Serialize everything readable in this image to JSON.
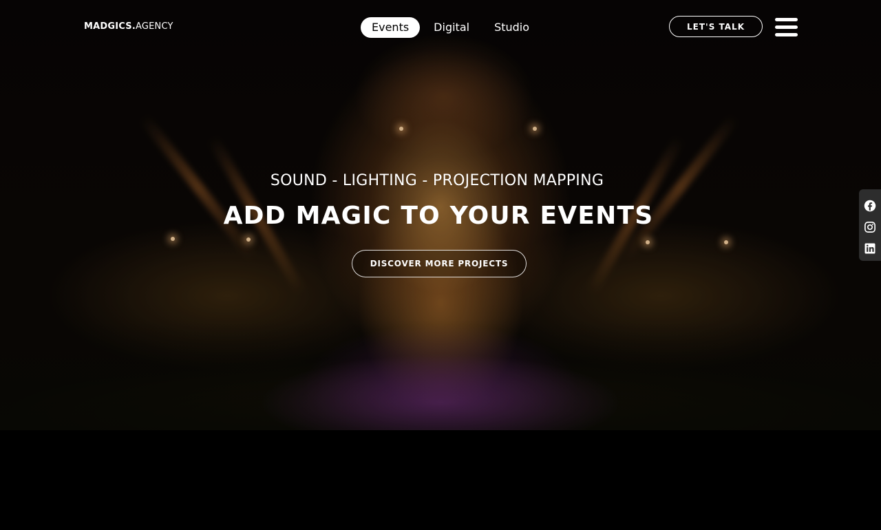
{
  "header": {
    "logo_main": "MADGICS.",
    "logo_suffix": "AGENCY",
    "nav": [
      {
        "label": "Events",
        "active": true
      },
      {
        "label": "Digital",
        "active": false
      },
      {
        "label": "Studio",
        "active": false
      }
    ],
    "cta_label": "LET'S TALK",
    "menu_icon": "hamburger-menu-icon"
  },
  "hero": {
    "kicker": "SOUND - LIGHTING - PROJECTION MAPPING",
    "headline": "ADD MAGIC TO YOUR EVENTS",
    "button_label": "DISCOVER MORE PROJECTS"
  },
  "social": {
    "icons": [
      "facebook-icon",
      "instagram-icon",
      "linkedin-icon"
    ]
  },
  "colors": {
    "background": "#000000",
    "text": "#ffffff",
    "active_tab_bg": "#ffffff",
    "social_bar_bg": "#2d2d2d"
  }
}
